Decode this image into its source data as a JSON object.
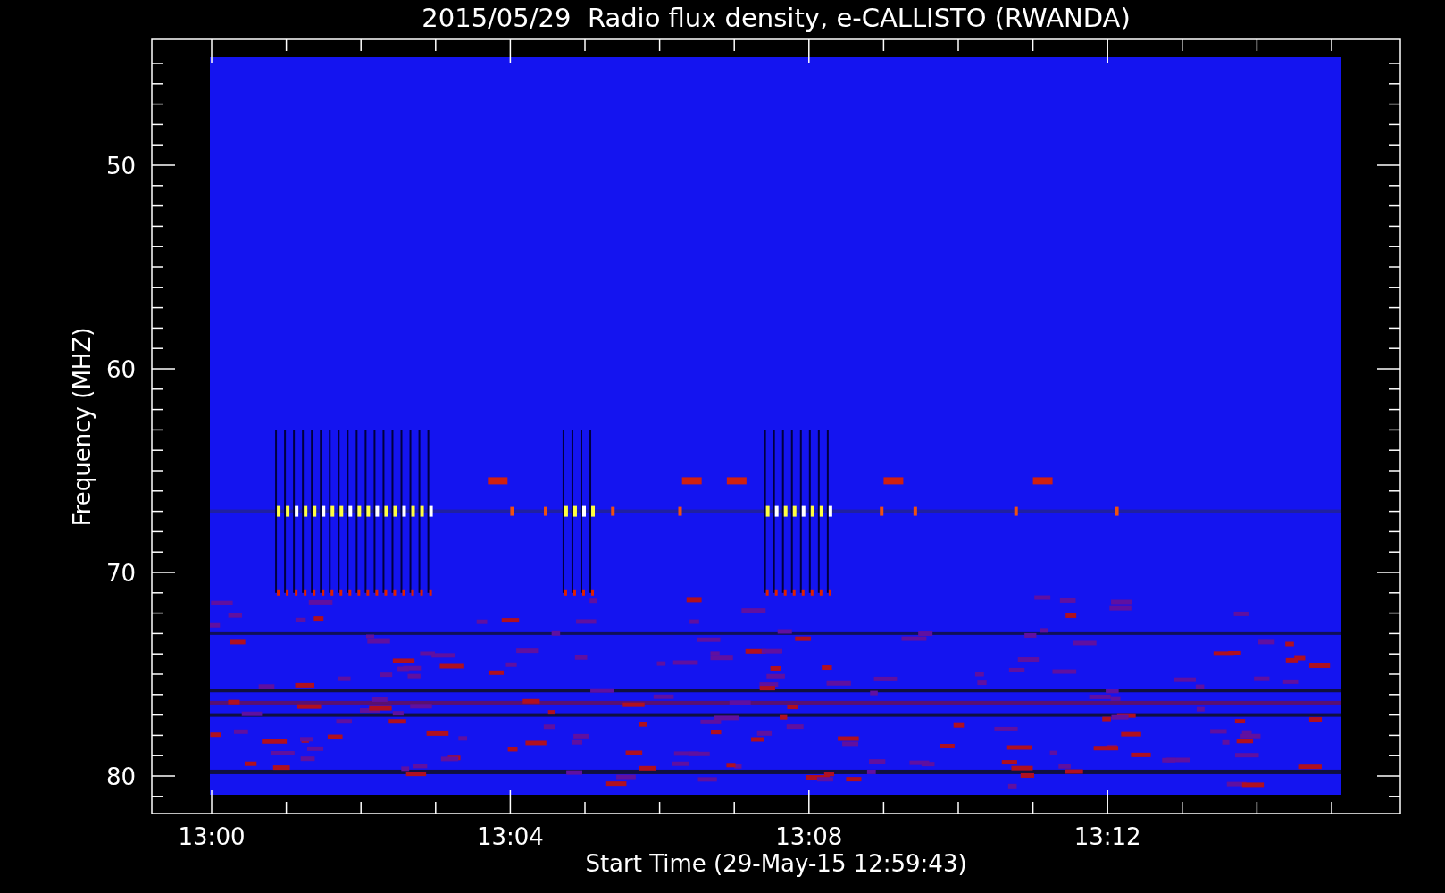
{
  "title": "2015/05/29  Radio flux density, e-CALLISTO (RWANDA)",
  "y_axis": {
    "label": "Frequency (MHZ)",
    "ticks": [
      "50",
      "60",
      "70",
      "80"
    ]
  },
  "x_axis": {
    "label": "Start Time (29-May-15 12:59:43)",
    "ticks": [
      "13:00",
      "13:04",
      "13:08",
      "13:12"
    ]
  }
}
